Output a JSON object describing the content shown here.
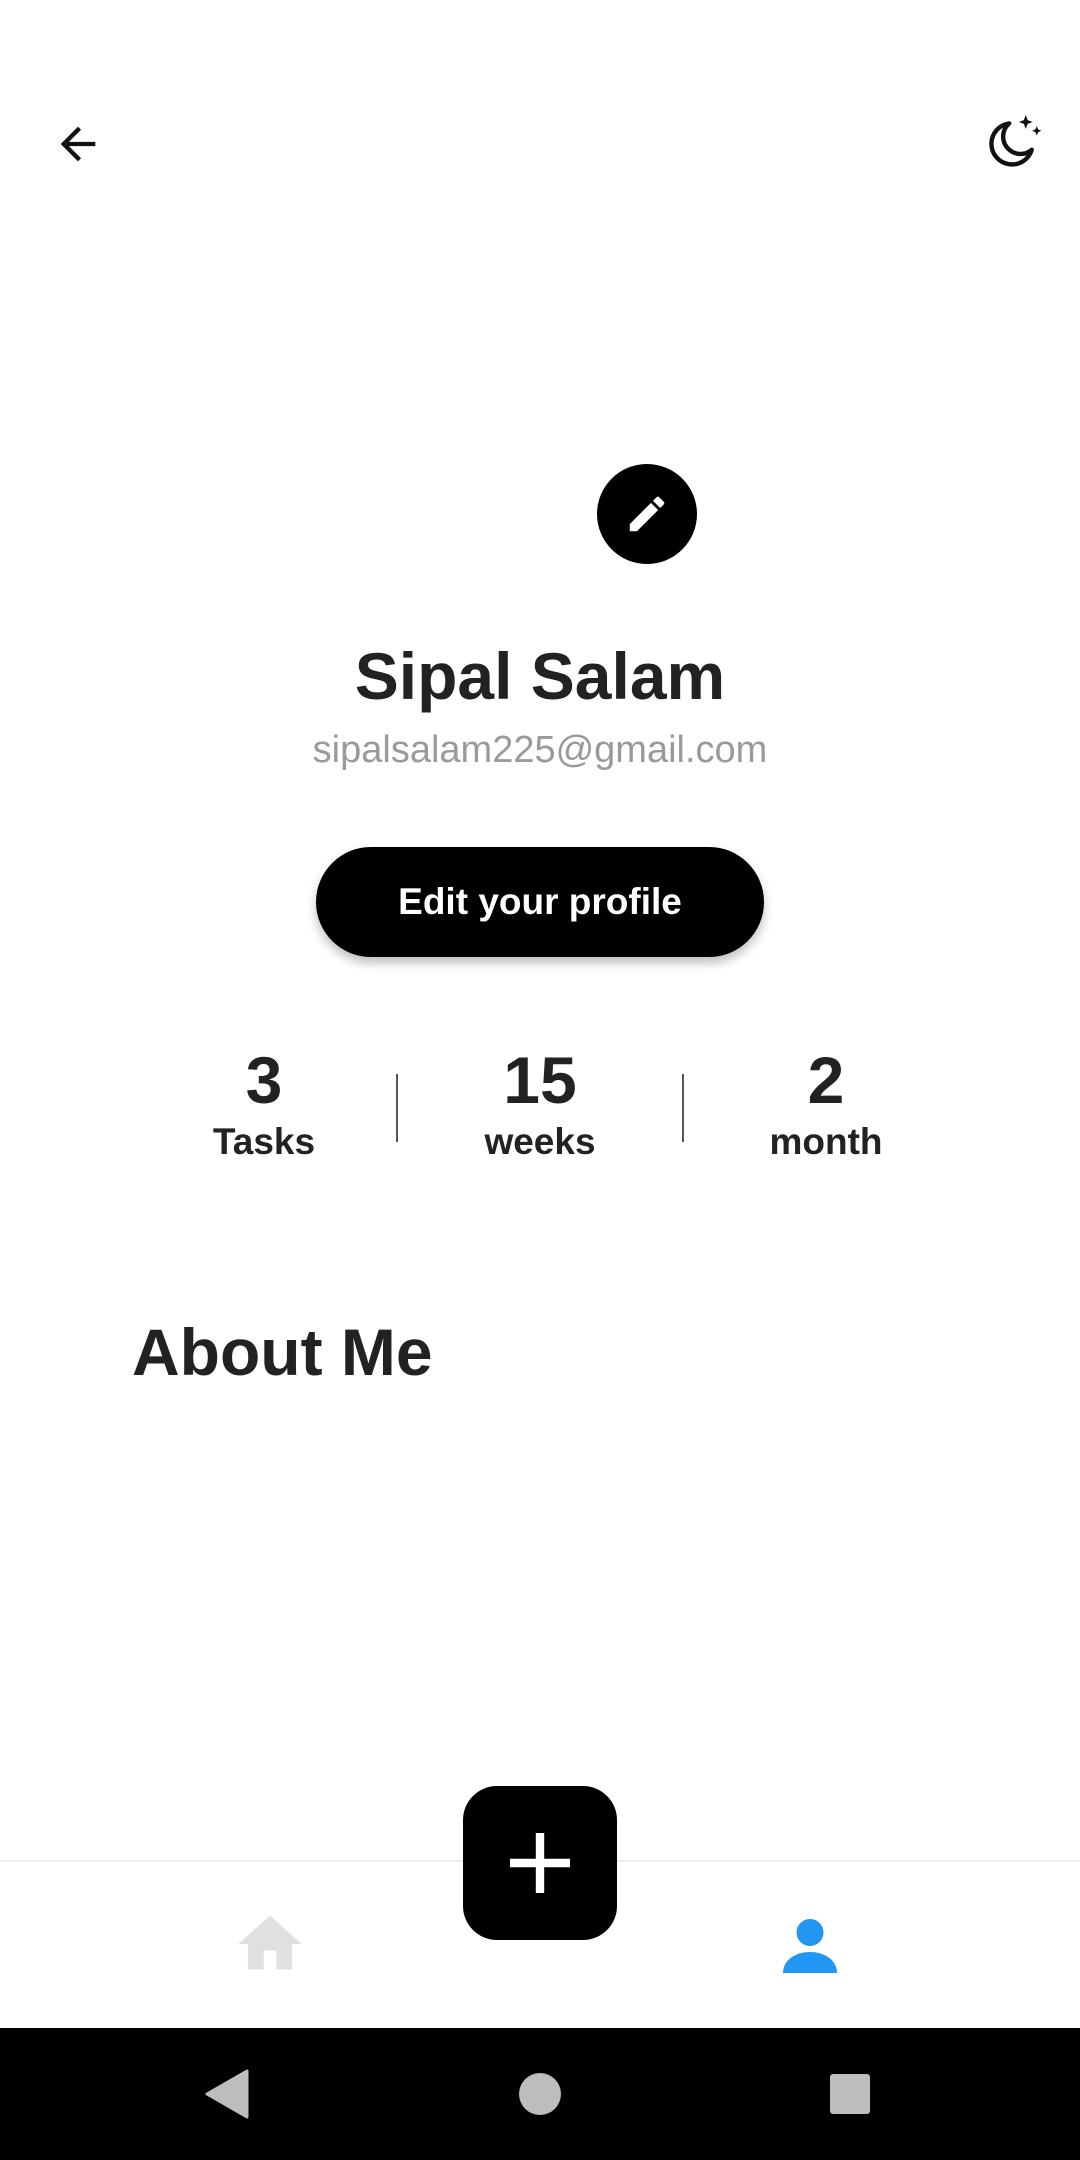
{
  "header": {
    "back_icon": "arrow-left-icon",
    "theme_icon": "moon-stars-icon"
  },
  "profile": {
    "edit_avatar_icon": "pencil-icon",
    "name": "Sipal Salam",
    "email": "sipalsalam225@gmail.com",
    "edit_button_label": "Edit your profile"
  },
  "stats": [
    {
      "value": "3",
      "label": "Tasks"
    },
    {
      "value": "15",
      "label": "weeks"
    },
    {
      "value": "2",
      "label": "month"
    }
  ],
  "about": {
    "title": "About Me"
  },
  "bottom_nav": {
    "home_icon": "home-icon",
    "add_icon": "plus-icon",
    "profile_icon": "person-icon",
    "active_color": "#2196F3",
    "inactive_color": "#E0E0E0"
  },
  "system_nav": {
    "back_icon": "triangle-back-icon",
    "home_icon": "circle-home-icon",
    "recents_icon": "square-recents-icon"
  }
}
